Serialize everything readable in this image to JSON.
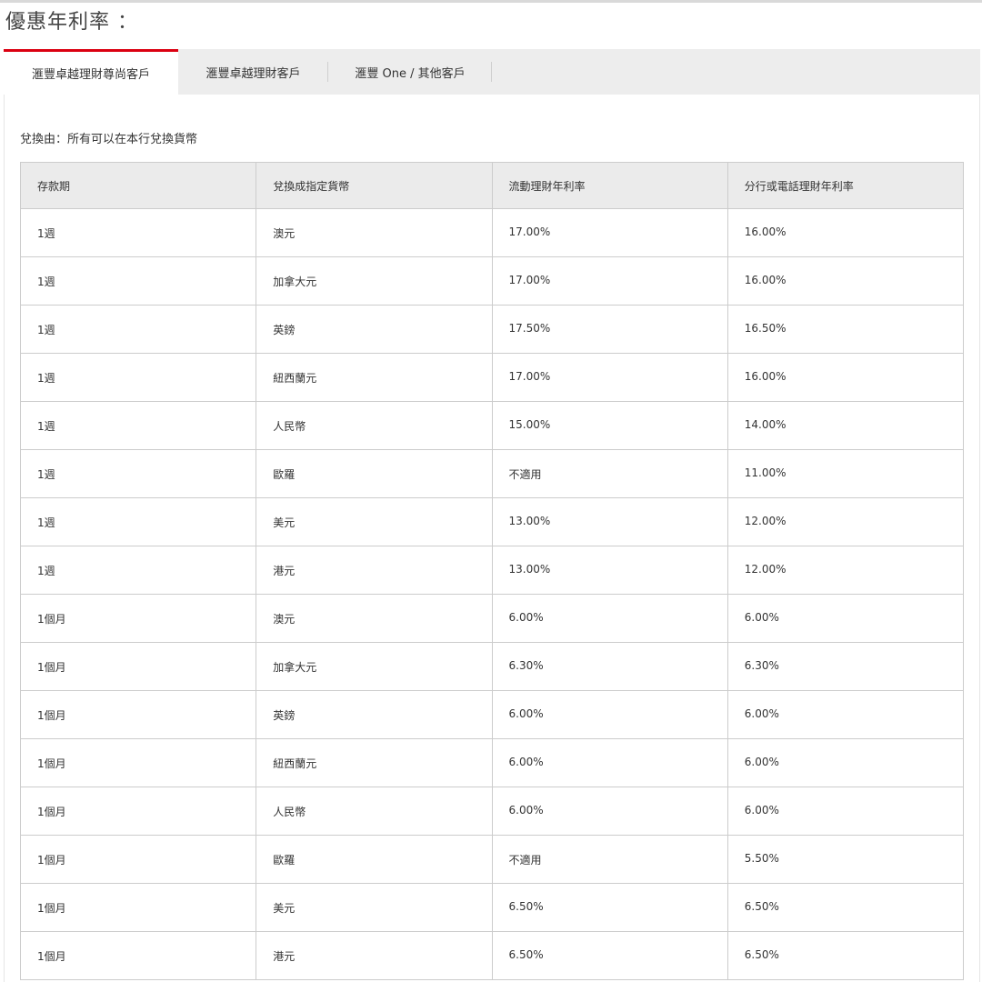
{
  "page_title": "優惠年利率 ：",
  "tabs": [
    {
      "label": "滙豐卓越理財尊尚客戶",
      "active": true
    },
    {
      "label": "滙豐卓越理財客戶",
      "active": false
    },
    {
      "label": "滙豐 One / 其他客戶",
      "active": false
    }
  ],
  "subtitle": "兌換由：所有可以在本行兌換貨幣",
  "table": {
    "headers": [
      "存款期",
      "兌換成指定貨幣",
      "流動理財年利率",
      "分行或電話理財年利率"
    ],
    "rows": [
      [
        "1週",
        "澳元",
        "17.00%",
        "16.00%"
      ],
      [
        "1週",
        "加拿大元",
        "17.00%",
        "16.00%"
      ],
      [
        "1週",
        "英鎊",
        "17.50%",
        "16.50%"
      ],
      [
        "1週",
        "紐西蘭元",
        "17.00%",
        "16.00%"
      ],
      [
        "1週",
        "人民幣",
        "15.00%",
        "14.00%"
      ],
      [
        "1週",
        "歐羅",
        "不適用",
        "11.00%"
      ],
      [
        "1週",
        "美元",
        "13.00%",
        "12.00%"
      ],
      [
        "1週",
        "港元",
        "13.00%",
        "12.00%"
      ],
      [
        "1個月",
        "澳元",
        "6.00%",
        "6.00%"
      ],
      [
        "1個月",
        "加拿大元",
        "6.30%",
        "6.30%"
      ],
      [
        "1個月",
        "英鎊",
        "6.00%",
        "6.00%"
      ],
      [
        "1個月",
        "紐西蘭元",
        "6.00%",
        "6.00%"
      ],
      [
        "1個月",
        "人民幣",
        "6.00%",
        "6.00%"
      ],
      [
        "1個月",
        "歐羅",
        "不適用",
        "5.50%"
      ],
      [
        "1個月",
        "美元",
        "6.50%",
        "6.50%"
      ],
      [
        "1個月",
        "港元",
        "6.50%",
        "6.50%"
      ]
    ]
  },
  "colors": {
    "accent": "#db0011",
    "tab_bar": "#ededed",
    "header_bg": "#ebebeb",
    "border": "#cccccc"
  }
}
